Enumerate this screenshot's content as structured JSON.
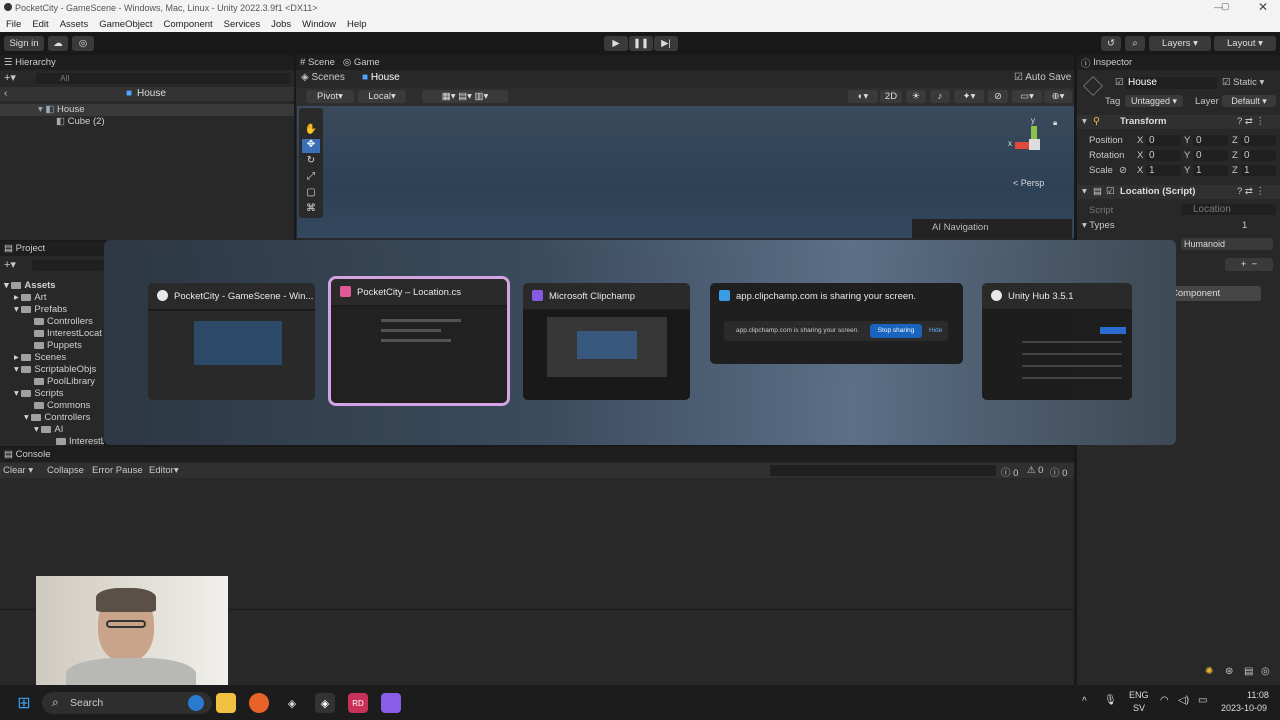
{
  "window": {
    "title": "PocketCity - GameScene - Windows, Mac, Linux - Unity 2022.3.9f1 <DX11>"
  },
  "menu": [
    "File",
    "Edit",
    "Assets",
    "GameObject",
    "Component",
    "Services",
    "Jobs",
    "Window",
    "Help"
  ],
  "toolbar": {
    "sign_in": "Sign in",
    "layers": "Layers",
    "layout": "Layout"
  },
  "hierarchy": {
    "title": "Hierarchy",
    "search_placeholder": "All",
    "header": "House",
    "items": [
      "House",
      "Cube (2)"
    ]
  },
  "scene_tabs": {
    "scene": "Scene",
    "game": "Game"
  },
  "scene_bar": {
    "scenes": "Scenes",
    "house": "House",
    "auto_save": "Auto Save"
  },
  "scene_tools": {
    "pivot": "Pivot",
    "local": "Local",
    "mode_2d": "2D",
    "persp": "Persp",
    "ai_nav": "AI Navigation"
  },
  "project": {
    "title": "Project",
    "tree": [
      "Assets",
      "Art",
      "Prefabs",
      "Controllers",
      "InterestLocat",
      "Puppets",
      "Scenes",
      "ScriptableObjs",
      "PoolLibrary",
      "Scripts",
      "Commons",
      "Controllers",
      "AI",
      "InterestL"
    ]
  },
  "switcher": {
    "cards": [
      {
        "title": "PocketCity - GameScene - Win...",
        "color": "#ffffff"
      },
      {
        "title": "PocketCity – Location.cs",
        "color": "#e85a9a"
      },
      {
        "title": "Microsoft Clipchamp",
        "color": "#8a5ce8"
      },
      {
        "title": "app.clipchamp.com is sharing your screen.",
        "color": "#3aa0e8"
      },
      {
        "title": "Unity Hub 3.5.1",
        "color": "#ffffff"
      }
    ],
    "share_text": "app.clipchamp.com is sharing your screen.",
    "stop_sharing": "Stop sharing",
    "hide": "Hide"
  },
  "console": {
    "title": "Console",
    "clear": "Clear",
    "collapse": "Collapse",
    "error_pause": "Error Pause",
    "editor": "Editor",
    "warn_count": "0",
    "err_count": "0",
    "info_count": "0"
  },
  "inspector": {
    "title": "Inspector",
    "object_name": "House",
    "static": "Static",
    "tag_label": "Tag",
    "tag": "Untagged",
    "layer_label": "Layer",
    "layer": "Default",
    "transform": "Transform",
    "position": {
      "label": "Position",
      "x": "0",
      "y": "0",
      "z": "0"
    },
    "rotation": {
      "label": "Rotation",
      "x": "0",
      "y": "0",
      "z": "0"
    },
    "scale": {
      "label": "Scale",
      "x": "1",
      "y": "1",
      "z": "1"
    },
    "location_script": "Location (Script)",
    "script_label": "Script",
    "script_value": "Location",
    "types_label": "Types",
    "types_value": "1",
    "humanoid": "Humanoid",
    "add_component": "Component"
  },
  "taskbar": {
    "search": "Search",
    "lang1": "ENG",
    "lang2": "SV",
    "time": "11:08",
    "date": "2023-10-09"
  }
}
